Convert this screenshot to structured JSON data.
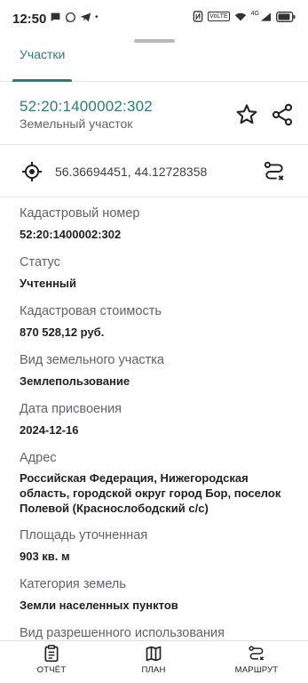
{
  "status_bar": {
    "time": "12:50",
    "network_label": "4G",
    "volte_label": "VoLTE"
  },
  "tabs": [
    {
      "label": "Участки"
    }
  ],
  "parcel": {
    "number": "52:20:1400002:302",
    "type": "Земельный участок"
  },
  "coordinates": "56.36694451, 44.12728358",
  "fields": [
    {
      "label": "Кадастровый номер",
      "value": "52:20:1400002:302"
    },
    {
      "label": "Статус",
      "value": "Учтенный"
    },
    {
      "label": "Кадастровая стоимость",
      "value": "870 528,12 руб."
    },
    {
      "label": "Вид земельного участка",
      "value": "Землепользование"
    },
    {
      "label": "Дата присвоения",
      "value": "2024-12-16"
    },
    {
      "label": "Адрес",
      "value": "Российская Федерация, Нижегородская область, городской округ город Бор, поселок Полевой (Краснослободский с/с)"
    },
    {
      "label": "Площадь уточненная",
      "value": "903 кв. м"
    },
    {
      "label": "Категория земель",
      "value": "Земли населенных пунктов"
    },
    {
      "label": "Вид разрешенного использования",
      "value": ""
    }
  ],
  "bottom_nav": {
    "report": "ОТЧЁТ",
    "plan": "ПЛАН",
    "route": "МАРШРУТ"
  },
  "colors": {
    "accent": "#2e7d74",
    "text_primary": "#202124",
    "text_secondary": "#5f6368"
  },
  "icons": [
    "message-icon",
    "whatsapp-icon",
    "telegram-icon",
    "nfc-icon",
    "wifi-icon",
    "signal-icon",
    "battery-icon",
    "star-icon",
    "share-icon",
    "target-icon",
    "route-icon",
    "report-icon",
    "map-icon"
  ]
}
